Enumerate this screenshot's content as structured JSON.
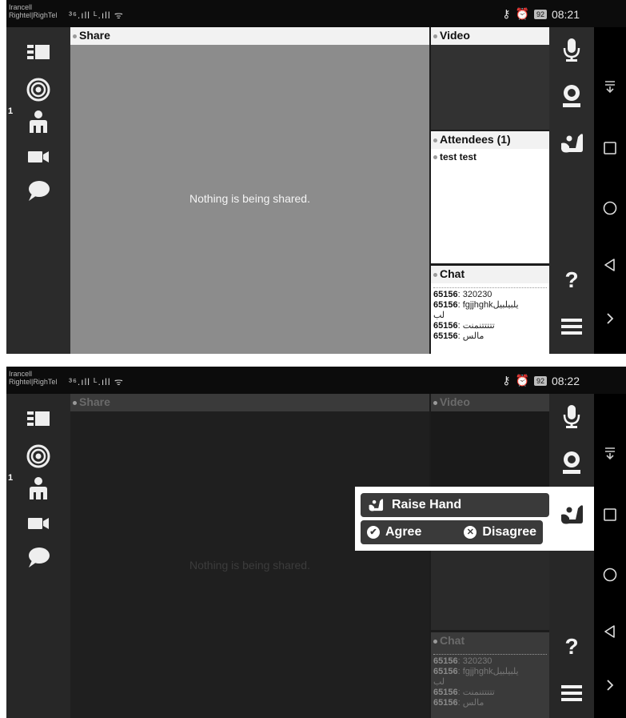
{
  "status_top": {
    "carrier1": "Irancell",
    "carrier2": "Rightel|RighTel",
    "signal": "³⁶.ıll ᴸ.ıll ",
    "battery": "92",
    "time": "08:21"
  },
  "status_bottom": {
    "carrier1": "Irancell",
    "carrier2": "Rightel|RighTel",
    "signal": "³⁶.ıll ᴸ.ıll ",
    "battery": "92",
    "time": "08:22"
  },
  "left_sidebar": {
    "attendee_count_badge": "1"
  },
  "share": {
    "title": "Share",
    "empty_message": "Nothing is being shared."
  },
  "video": {
    "title": "Video"
  },
  "attendees": {
    "title": "Attendees (1)",
    "items": [
      "test test"
    ]
  },
  "chat": {
    "title": "Chat",
    "messages": [
      {
        "sender": "65156",
        "text": "320230"
      },
      {
        "sender": "65156",
        "text": "fgjjhghkیلبیلبیل"
      },
      {
        "sender": "",
        "text": "لب"
      },
      {
        "sender": "65156",
        "text": "تتتتتنمنت"
      },
      {
        "sender": "65156",
        "text": "مالس"
      }
    ]
  },
  "right_toolbar": {
    "help_label": "?"
  },
  "popup": {
    "raise_hand_label": "Raise Hand",
    "agree_label": "Agree",
    "disagree_label": "Disagree"
  },
  "icons": [
    "layout-icon",
    "target-icon",
    "person-icon",
    "camera-icon",
    "chat-bubble-icon",
    "microphone-icon",
    "webcam-icon",
    "raise-hand-icon",
    "help-icon",
    "menu-icon",
    "status-icon",
    "square-icon",
    "circle-icon",
    "back-icon",
    "chevron-right-icon"
  ],
  "colors": {
    "toolbar_bg": "#2b2b2b",
    "share_bg": "#8c8c8c",
    "header_bg": "#f2f2f2",
    "popup_btn": "#3a3a3a"
  }
}
